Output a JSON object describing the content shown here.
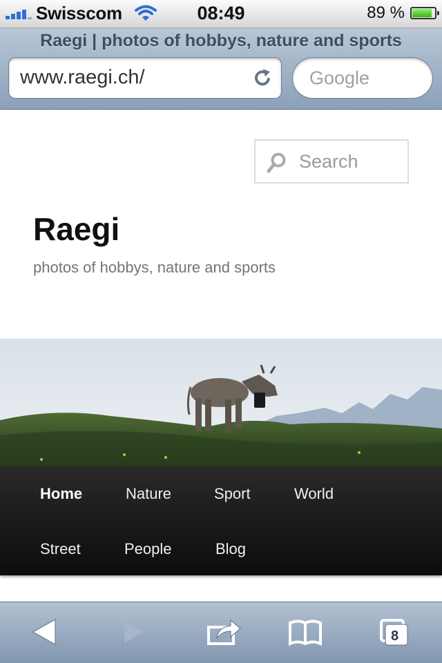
{
  "status_bar": {
    "carrier": "Swisscom",
    "time": "08:49",
    "battery_percent": "89 %",
    "battery_level": 0.89
  },
  "safari": {
    "page_title": "Raegi | photos of hobbys, nature and sports",
    "url": "www.raegi.ch/",
    "search_placeholder": "Google",
    "tab_count": "8"
  },
  "site": {
    "search_placeholder": "Search",
    "title": "Raegi",
    "description": "photos of hobbys, nature and sports",
    "nav": [
      {
        "label": "Home",
        "active": true
      },
      {
        "label": "Nature"
      },
      {
        "label": "Sport"
      },
      {
        "label": "World"
      },
      {
        "label": "Street"
      },
      {
        "label": "People"
      },
      {
        "label": "Blog"
      }
    ]
  },
  "toolbar_icons": [
    "back-icon",
    "forward-icon",
    "share-icon",
    "bookmarks-icon",
    "tabs-icon"
  ],
  "colors": {
    "nav_background": "#151515",
    "toolbar_blue": "#8ba0b9",
    "signal_blue": "#2f6ed3"
  }
}
